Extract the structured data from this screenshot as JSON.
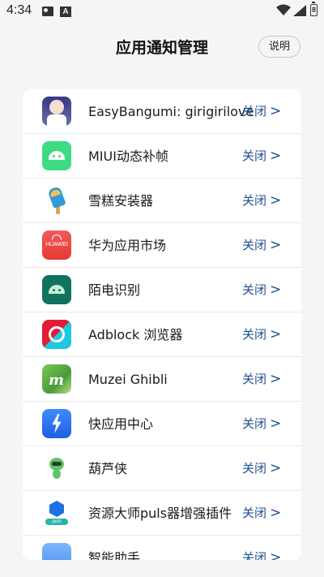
{
  "status_bar": {
    "time": "4:34",
    "battery_digit": "8"
  },
  "header": {
    "title": "应用通知管理",
    "help_label": "说明"
  },
  "toggle_label": "关闭",
  "chevron": ">",
  "apps": [
    {
      "name": "EasyBangumi: girigirilove",
      "icon": "anime-girl-icon",
      "status": "关闭"
    },
    {
      "name": "MIUI动态补帧",
      "icon": "android-robot-icon",
      "status": "关闭"
    },
    {
      "name": "雪糕安装器",
      "icon": "popsicle-icon",
      "status": "关闭"
    },
    {
      "name": "华为应用市场",
      "icon": "huawei-appgallery-icon",
      "status": "关闭",
      "icon_text": "HUAWEI"
    },
    {
      "name": "陌电识别",
      "icon": "android-robot-dark-icon",
      "status": "关闭"
    },
    {
      "name": "Adblock 浏览器",
      "icon": "adblock-icon",
      "status": "关闭"
    },
    {
      "name": "Muzei Ghibli",
      "icon": "muzei-icon",
      "status": "关闭"
    },
    {
      "name": "快应用中心",
      "icon": "lightning-bolt-icon",
      "status": "关闭"
    },
    {
      "name": "葫芦侠",
      "icon": "gourd-icon",
      "status": "关闭"
    },
    {
      "name": "资源大师puls器增强插件",
      "icon": "resource-master-icon",
      "status": "关闭",
      "icon_text": "puls"
    },
    {
      "name": "智能助手",
      "icon": "assistant-icon",
      "status": "关闭"
    }
  ],
  "colors": {
    "background": "#f5f5f5",
    "card": "#ffffff",
    "toggle_text": "#1e4f8f"
  }
}
